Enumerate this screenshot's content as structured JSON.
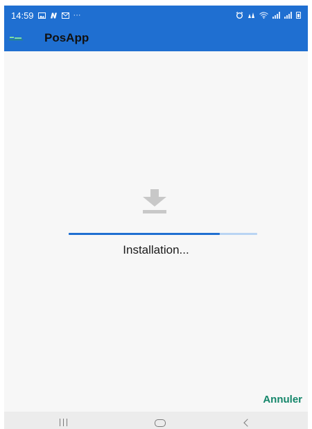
{
  "status_bar": {
    "time": "14:59",
    "icons": [
      "gallery-icon",
      "n-icon",
      "mail-icon",
      "more-icon",
      "alarm-icon",
      "signal-icon",
      "wifi-icon",
      "cell-signal-icon",
      "battery-icon"
    ],
    "more_glyph": "···"
  },
  "app_bar": {
    "title": "PosApp",
    "icon": "app-logo-icon"
  },
  "install": {
    "icon": "download-icon",
    "progress": 0.8,
    "status_text": "Installation...",
    "cancel_label": "Annuler"
  },
  "nav_bar": {
    "buttons": [
      "recent-apps-icon",
      "home-icon",
      "back-icon"
    ]
  },
  "colors": {
    "primary": "#1f6fd1",
    "progress_track": "#b9d4f3",
    "accent": "#14866a",
    "background": "#f7f7f7"
  }
}
